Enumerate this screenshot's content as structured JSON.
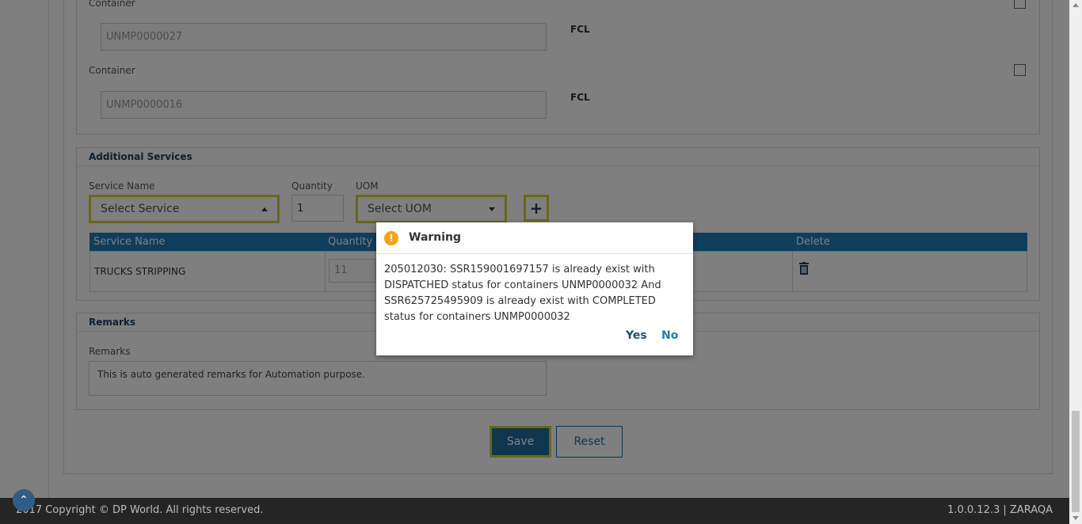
{
  "containers": [
    {
      "label": "Container",
      "value": "UNMP0000027",
      "type": "FCL"
    },
    {
      "label": "Container",
      "value": "UNMP0000016",
      "type": "FCL"
    }
  ],
  "additional_services": {
    "title": "Additional Services",
    "service_name_label": "Service Name",
    "service_placeholder": "Select Service",
    "quantity_label": "Quantity",
    "quantity_value": "1",
    "uom_label": "UOM",
    "uom_placeholder": "Select UOM",
    "add_icon": "plus-icon",
    "table": {
      "columns": [
        "Service Name",
        "Quantity",
        "Delete"
      ],
      "rows": [
        {
          "service_name": "TRUCKS STRIPPING",
          "quantity": "11",
          "delete_icon": "trash-icon"
        }
      ]
    }
  },
  "remarks": {
    "title": "Remarks",
    "label": "Remarks",
    "value": "This is auto generated remarks for Automation purpose."
  },
  "actions": {
    "save": "Save",
    "reset": "Reset"
  },
  "footer": {
    "copyright": "2017 Copyright © DP World. All rights reserved.",
    "version": "1.0.0.12.3 | ZARAQA"
  },
  "modal": {
    "title": "Warning",
    "icon": "!",
    "message": "205012030: SSR159001697157 is already exist with DISPATCHED status for containers UNMP0000032 And SSR625725495909 is already exist with COMPLETED status for containers UNMP0000032",
    "yes": "Yes",
    "no": "No"
  },
  "colors": {
    "accent": "#1f7ab8",
    "highlight": "#cfcf33",
    "warning": "#f5a31a",
    "footer_bg": "#252525"
  }
}
